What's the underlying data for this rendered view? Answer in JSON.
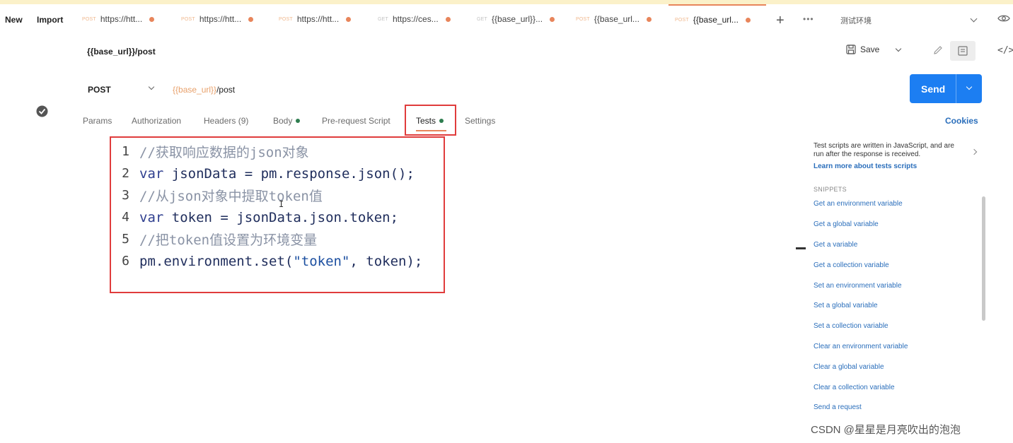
{
  "header": {
    "new_label": "New",
    "import_label": "Import"
  },
  "tabs": [
    {
      "method": "POST",
      "label": "https://htt...",
      "active": false
    },
    {
      "method": "POST",
      "label": "https://htt...",
      "active": false
    },
    {
      "method": "POST",
      "label": "https://htt...",
      "active": false
    },
    {
      "method": "GET",
      "label": "https://ces...",
      "active": false
    },
    {
      "method": "GET",
      "label": "{{base_url}}...",
      "active": false
    },
    {
      "method": "POST",
      "label": "{{base_url...",
      "active": false
    },
    {
      "method": "POST",
      "label": "{{base_url...",
      "active": true
    }
  ],
  "environment": {
    "selected": "测试环境"
  },
  "request": {
    "name": "{{base_url}}/post",
    "method": "POST",
    "url_var": "{{base_url}}",
    "url_path": "/post",
    "save_label": "Save",
    "send_label": "Send"
  },
  "subtabs": {
    "params": "Params",
    "authorization": "Authorization",
    "headers": "Headers (9)",
    "body": "Body",
    "prerequest": "Pre-request Script",
    "tests": "Tests",
    "settings": "Settings",
    "cookies": "Cookies"
  },
  "code": {
    "line_numbers": [
      "1",
      "2",
      "3",
      "4",
      "5",
      "6"
    ],
    "line1": "//获取响应数据的json对象",
    "line2_kw": "var",
    "line2_rest": " jsonData = pm.response.json();",
    "line3": "//从json对象中提取token值",
    "line4_kw": "var",
    "line4_rest": " token = jsonData.json.token;",
    "line5": "//把token值设置为环境变量",
    "line6_pre": "pm.environment.set(",
    "line6_str": "\"token\"",
    "line6_post": ", token);"
  },
  "side_panel": {
    "info_text": "Test scripts are written in JavaScript, and are run after the response is received.",
    "info_link": "Learn more about tests scripts",
    "snippets_heading": "SNIPPETS",
    "snippets": [
      "Get an environment variable",
      "Get a global variable",
      "Get a variable",
      "Get a collection variable",
      "Set an environment variable",
      "Set a global variable",
      "Set a collection variable",
      "Clear an environment variable",
      "Clear a global variable",
      "Clear a collection variable",
      "Send a request"
    ]
  },
  "watermark": "CSDN @星星是月亮吹出的泡泡",
  "colors": {
    "accent": "#e8855b",
    "send": "#1c7ef2",
    "highlight": "#e03c3c",
    "link": "#2a6ebb",
    "status_dot": "#2e7d4f"
  }
}
